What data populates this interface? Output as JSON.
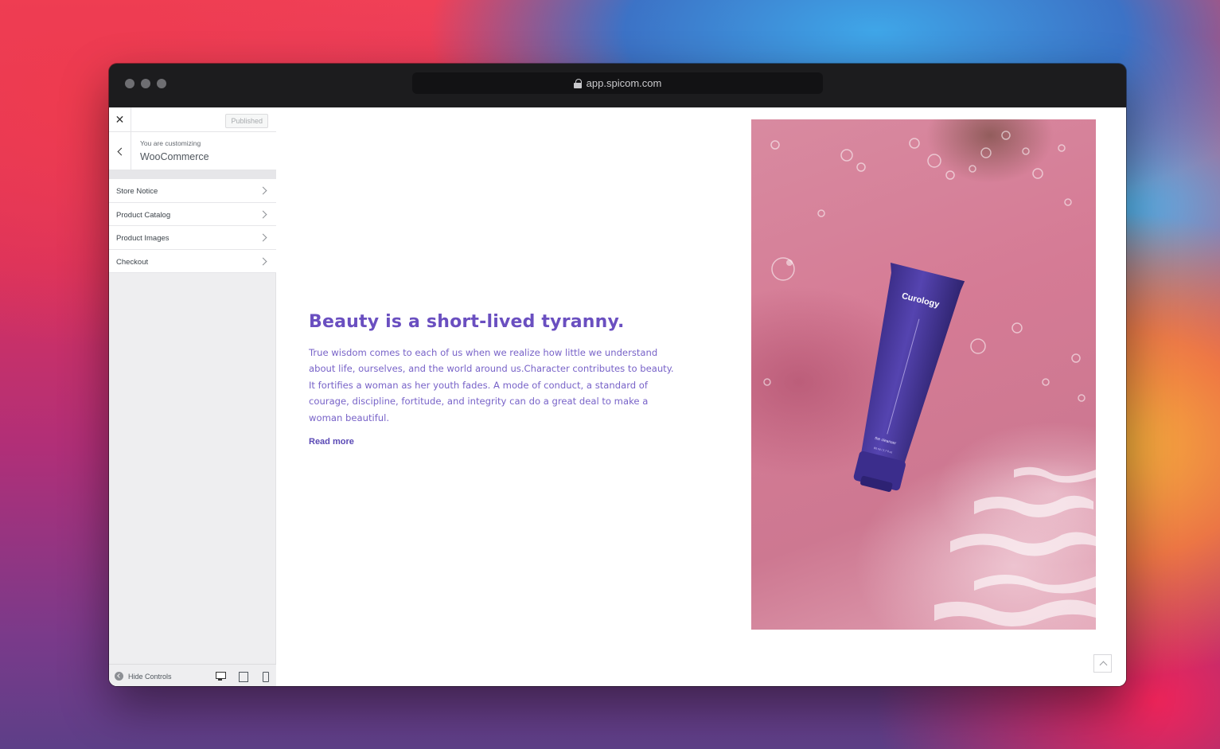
{
  "browser": {
    "url": "app.spicom.com"
  },
  "sidebar": {
    "close_label": "✕",
    "status_label": "Published",
    "customizing_label": "You are customizing",
    "customizing_title": "WooCommerce",
    "items": [
      {
        "label": "Store Notice"
      },
      {
        "label": "Product Catalog"
      },
      {
        "label": "Product Images"
      },
      {
        "label": "Checkout"
      }
    ],
    "footer": {
      "hide_controls_label": "Hide Controls",
      "devices": [
        "desktop-icon",
        "tablet-icon",
        "mobile-icon"
      ]
    }
  },
  "preview": {
    "headline": "Beauty is a short-lived tyranny.",
    "body": "True wisdom comes to each of us when we realize how little we understand about life, ourselves, and the world around us.Character contributes to beauty. It fortifies a woman as her youth fades. A mode of conduct, a standard of courage, discipline, fortitude, and integrity can do a great deal to make a woman beautiful.",
    "read_more": "Read more",
    "product": {
      "brand": "Curology",
      "name": "the cleanser",
      "size": "80 ml / 2.7 fl oz"
    }
  },
  "colors": {
    "accent_text": "#6a4fc0",
    "product_tube": "#4a3a9a",
    "photo_background": "#d88aa0"
  }
}
